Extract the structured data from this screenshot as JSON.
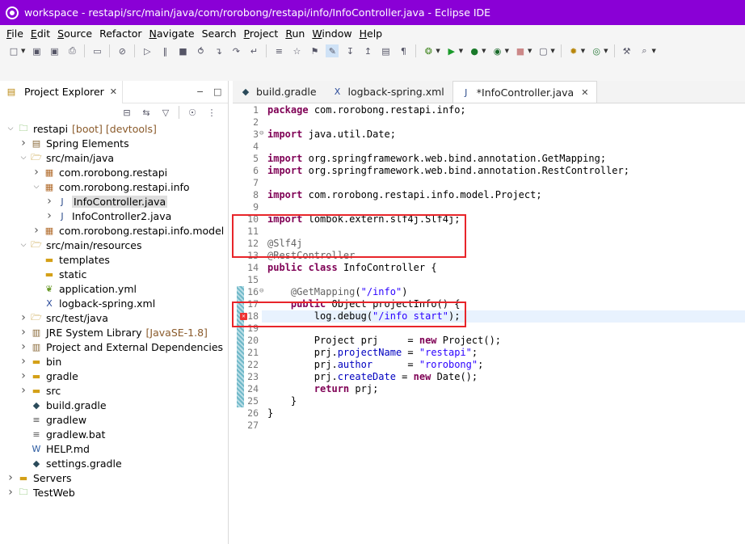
{
  "window": {
    "title": "workspace - restapi/src/main/java/com/rorobong/restapi/info/InfoController.java - Eclipse IDE"
  },
  "menu": [
    {
      "label": "File",
      "mn": "F",
      "rest": "ile"
    },
    {
      "label": "Edit",
      "mn": "E",
      "rest": "dit"
    },
    {
      "label": "Source",
      "mn": "S",
      "rest": "ource"
    },
    {
      "label": "Refactor",
      "mn": "",
      "rest": "Refactor"
    },
    {
      "label": "Navigate",
      "mn": "N",
      "rest": "avigate"
    },
    {
      "label": "Search",
      "mn": "",
      "rest": "Search"
    },
    {
      "label": "Project",
      "mn": "P",
      "rest": "roject"
    },
    {
      "label": "Run",
      "mn": "R",
      "rest": "un"
    },
    {
      "label": "Window",
      "mn": "W",
      "rest": "indow"
    },
    {
      "label": "Help",
      "mn": "H",
      "rest": "elp"
    }
  ],
  "explorer": {
    "tab_label": "Project Explorer",
    "tree": [
      {
        "label": "restapi",
        "decor": "[boot] [devtools]",
        "icon": "project-icon",
        "twisty": "open"
      },
      {
        "label": "Spring Elements",
        "icon": "spring-icon",
        "twisty": "closed"
      },
      {
        "label": "src/main/java",
        "icon": "source-folder-icon",
        "twisty": "open"
      },
      {
        "label": "com.rorobong.restapi",
        "icon": "package-icon",
        "twisty": "closed"
      },
      {
        "label": "com.rorobong.restapi.info",
        "icon": "package-icon",
        "twisty": "open"
      },
      {
        "label": "InfoController.java",
        "icon": "java-file-icon",
        "twisty": "closed",
        "selected": true
      },
      {
        "label": "InfoController2.java",
        "icon": "java-file-icon",
        "twisty": "closed"
      },
      {
        "label": "com.rorobong.restapi.info.model",
        "icon": "package-icon",
        "twisty": "closed"
      },
      {
        "label": "src/main/resources",
        "icon": "source-folder-icon",
        "twisty": "open"
      },
      {
        "label": "templates",
        "icon": "folder-icon",
        "twisty": ""
      },
      {
        "label": "static",
        "icon": "folder-icon",
        "twisty": ""
      },
      {
        "label": "application.yml",
        "icon": "yaml-file-icon",
        "twisty": ""
      },
      {
        "label": "logback-spring.xml",
        "icon": "xml-file-icon",
        "twisty": ""
      },
      {
        "label": "src/test/java",
        "icon": "source-folder-icon",
        "twisty": "closed"
      },
      {
        "label": "JRE System Library",
        "decor": "[JavaSE-1.8]",
        "icon": "library-icon",
        "twisty": "closed"
      },
      {
        "label": "Project and External Dependencies",
        "icon": "library-icon",
        "twisty": "closed"
      },
      {
        "label": "bin",
        "icon": "folder-icon",
        "twisty": "closed"
      },
      {
        "label": "gradle",
        "icon": "folder-icon",
        "twisty": "closed"
      },
      {
        "label": "src",
        "icon": "folder-icon",
        "twisty": "closed"
      },
      {
        "label": "build.gradle",
        "icon": "gradle-icon",
        "twisty": ""
      },
      {
        "label": "gradlew",
        "icon": "text-file-icon",
        "twisty": ""
      },
      {
        "label": "gradlew.bat",
        "icon": "text-file-icon",
        "twisty": ""
      },
      {
        "label": "HELP.md",
        "icon": "markdown-file-icon",
        "twisty": ""
      },
      {
        "label": "settings.gradle",
        "icon": "gradle-icon",
        "twisty": ""
      },
      {
        "label": "Servers",
        "icon": "folder-icon",
        "twisty": "closed"
      },
      {
        "label": "TestWeb",
        "icon": "project-icon",
        "twisty": "closed"
      }
    ]
  },
  "editor": {
    "tabs": [
      {
        "label": "build.gradle",
        "icon": "gradle-icon",
        "active": false
      },
      {
        "label": "logback-spring.xml",
        "icon": "xml-file-icon",
        "active": false
      },
      {
        "label": "*InfoController.java",
        "icon": "java-file-icon",
        "active": true
      }
    ],
    "lines": [
      {
        "n": "1",
        "parts": [
          [
            "kw",
            "package"
          ],
          [
            "",
            "com.rorobong.restapi.info;"
          ]
        ]
      },
      {
        "n": "2",
        "parts": []
      },
      {
        "n": "3",
        "parts": [
          [
            "kw",
            "import"
          ],
          [
            "",
            "java.util.Date;"
          ]
        ]
      },
      {
        "n": "4",
        "parts": []
      },
      {
        "n": "5",
        "parts": [
          [
            "kw",
            "import"
          ],
          [
            "",
            "org.springframework.web.bind.annotation.GetMapping;"
          ]
        ]
      },
      {
        "n": "6",
        "parts": [
          [
            "kw",
            "import"
          ],
          [
            "",
            "org.springframework.web.bind.annotation.RestController;"
          ]
        ]
      },
      {
        "n": "7",
        "parts": []
      },
      {
        "n": "8",
        "parts": [
          [
            "kw",
            "import"
          ],
          [
            "",
            "com.rorobong.restapi.info.model.Project;"
          ]
        ]
      },
      {
        "n": "9",
        "parts": []
      },
      {
        "n": "10",
        "parts": [
          [
            "kw",
            "import"
          ],
          [
            "",
            "lombok.extern.slf4j.Slf4j;"
          ]
        ]
      },
      {
        "n": "11",
        "parts": []
      },
      {
        "n": "12",
        "parts": [
          [
            "ann",
            "@Slf4j"
          ]
        ]
      },
      {
        "n": "13",
        "parts": [
          [
            "ann",
            "@RestController"
          ]
        ]
      },
      {
        "n": "14",
        "parts": [
          [
            "kw",
            "public"
          ],
          [
            "kw",
            "class"
          ],
          [
            "",
            "InfoController {"
          ]
        ]
      },
      {
        "n": "15",
        "parts": []
      },
      {
        "n": "16",
        "parts": [
          [
            "ind",
            "    "
          ],
          [
            "ann",
            "@GetMapping"
          ],
          [
            "",
            "("
          ],
          [
            "str",
            "\"/info\""
          ],
          [
            "",
            ")"
          ]
        ]
      },
      {
        "n": "17",
        "parts": [
          [
            "ind",
            "    "
          ],
          [
            "kw",
            "public"
          ],
          [
            "",
            "Object projectInfo() {"
          ]
        ]
      },
      {
        "n": "18",
        "parts": [
          [
            "ind",
            "        "
          ],
          [
            "",
            "log.debug("
          ],
          [
            "str",
            "\"/info start\""
          ],
          [
            "",
            ");"
          ]
        ]
      },
      {
        "n": "19",
        "parts": []
      },
      {
        "n": "20",
        "parts": [
          [
            "ind",
            "        "
          ],
          [
            "",
            "Project prj     = "
          ],
          [
            "kw",
            "new"
          ],
          [
            "",
            "Project();"
          ]
        ]
      },
      {
        "n": "21",
        "parts": [
          [
            "ind",
            "        "
          ],
          [
            "",
            "prj."
          ],
          [
            "fld",
            "projectName"
          ],
          [
            "",
            " = "
          ],
          [
            "str",
            "\"restapi\""
          ],
          [
            "",
            ";"
          ]
        ]
      },
      {
        "n": "22",
        "parts": [
          [
            "ind",
            "        "
          ],
          [
            "",
            "prj."
          ],
          [
            "fld",
            "author"
          ],
          [
            "",
            "      = "
          ],
          [
            "str",
            "\"rorobong\""
          ],
          [
            "",
            ";"
          ]
        ]
      },
      {
        "n": "23",
        "parts": [
          [
            "ind",
            "        "
          ],
          [
            "",
            "prj."
          ],
          [
            "fld",
            "createDate"
          ],
          [
            "",
            " = "
          ],
          [
            "kw",
            "new"
          ],
          [
            "",
            "Date();"
          ]
        ]
      },
      {
        "n": "24",
        "parts": [
          [
            "ind",
            "        "
          ],
          [
            "kw",
            "return"
          ],
          [
            "",
            "prj;"
          ]
        ]
      },
      {
        "n": "25",
        "parts": [
          [
            "ind",
            "    "
          ],
          [
            "",
            "}"
          ]
        ]
      },
      {
        "n": "26",
        "parts": [
          [
            "",
            "}"
          ]
        ]
      },
      {
        "n": "27",
        "parts": []
      }
    ]
  }
}
